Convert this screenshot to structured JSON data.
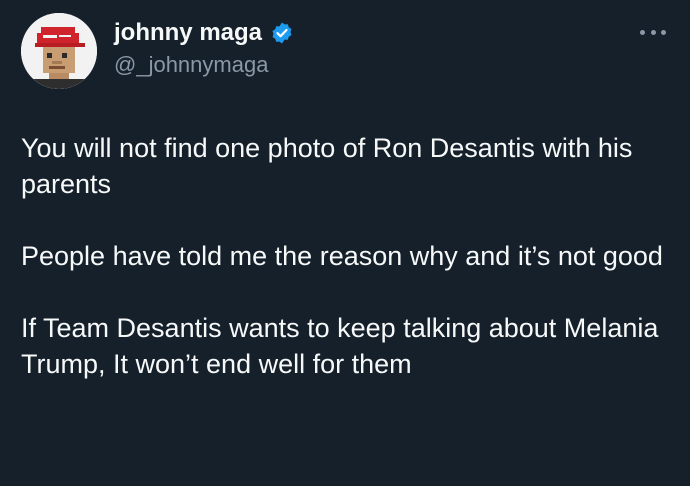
{
  "author": {
    "display_name": "johnny maga",
    "handle": "@_johnnymaga",
    "verified": true,
    "avatar_icon": "pixel-avatar-red-cap-icon"
  },
  "tweet": {
    "paragraphs": [
      "You will not find one photo of Ron Desantis with his parents",
      "People have told me the reason why and it’s not good",
      "If Team Desantis wants to keep talking about Melania Trump, It won’t end well for them"
    ]
  },
  "icons": {
    "verified": "verified-badge-icon",
    "more": "more-options-icon"
  },
  "colors": {
    "background": "#15202b",
    "text_primary": "#f7f9f9",
    "text_secondary": "#8b98a5",
    "verified_blue": "#1d9bf0",
    "cap_red": "#d0242c"
  }
}
